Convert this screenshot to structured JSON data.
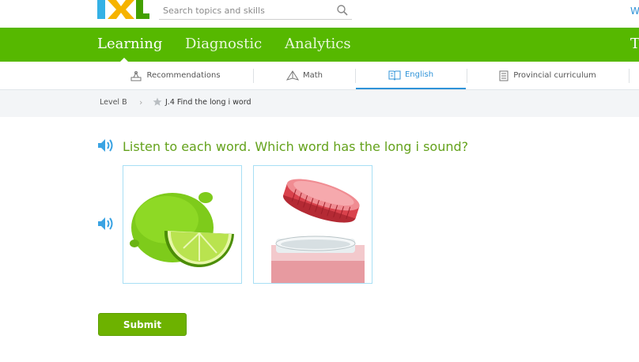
{
  "header": {
    "logo_text": "IXL",
    "search_placeholder": "Search topics and skills",
    "top_right_partial": "W"
  },
  "nav": {
    "tabs": [
      "Learning",
      "Diagnostic",
      "Analytics",
      "T"
    ],
    "active": "Learning"
  },
  "subnav": {
    "items": [
      "Recommendations",
      "Math",
      "English",
      "Provincial curriculum"
    ],
    "active": "English"
  },
  "breadcrumb": {
    "level": "Level B",
    "separator": "›",
    "skill": "J.4 Find the long i word"
  },
  "question": {
    "text": "Listen to each word. Which word has the long i sound?"
  },
  "choices": [
    {
      "icon": "lime-picture"
    },
    {
      "icon": "jar-with-lid-picture"
    }
  ],
  "actions": {
    "submit_label": "Submit"
  },
  "colors": {
    "nav_green": "#56b800",
    "question_green": "#64a21c",
    "link_blue": "#2f93d8",
    "submit_green": "#6db200"
  }
}
